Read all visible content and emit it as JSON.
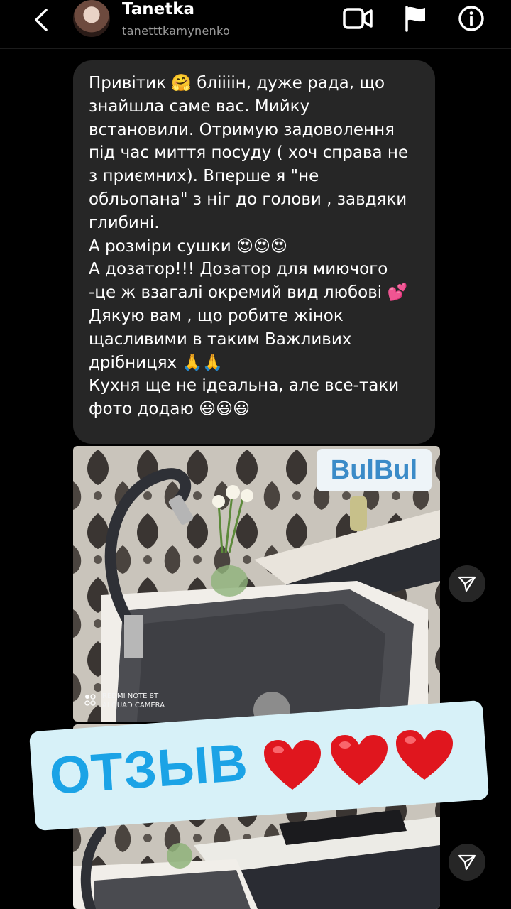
{
  "header": {
    "username": "Tanetka",
    "handle": "tanetttkamynenko",
    "icons": [
      "back-chevron-icon",
      "video-call-icon",
      "flag-icon",
      "info-icon"
    ]
  },
  "message": {
    "lines": [
      "Привітик 🤗 бліііін, дуже рада, що\nзнайшла саме вас. Мийку\nвстановили. Отримую задоволення\nпід час миття посуду ( хоч справа не\nз приємних). Вперше я \"не\nобльопана\" з ніг до голови , завдяки\nглибині.",
      "А розміри сушки 😍😍😍",
      "А дозатор!!! Дозатор для миючого\n-це ж взагалі окремий вид любові 💕",
      "Дякую вам , що робите жінок\nщасливими в таким Важливих\nдрібницях 🙏🙏",
      "Кухня ще не ідеальна, але все-таки\nфото додаю 😃😃😃"
    ]
  },
  "photo": {
    "logo": "BulBul",
    "watermark_line1": "REDMI NOTE 8T",
    "watermark_line2": "AI QUAD CAMERA"
  },
  "banner": {
    "text": "ОТЗЫВ"
  },
  "colors": {
    "background": "#000000",
    "bubble": "#262626",
    "banner_bg": "#d7f1f8",
    "banner_text": "#1ba3e6",
    "heart": "#e0161e"
  }
}
